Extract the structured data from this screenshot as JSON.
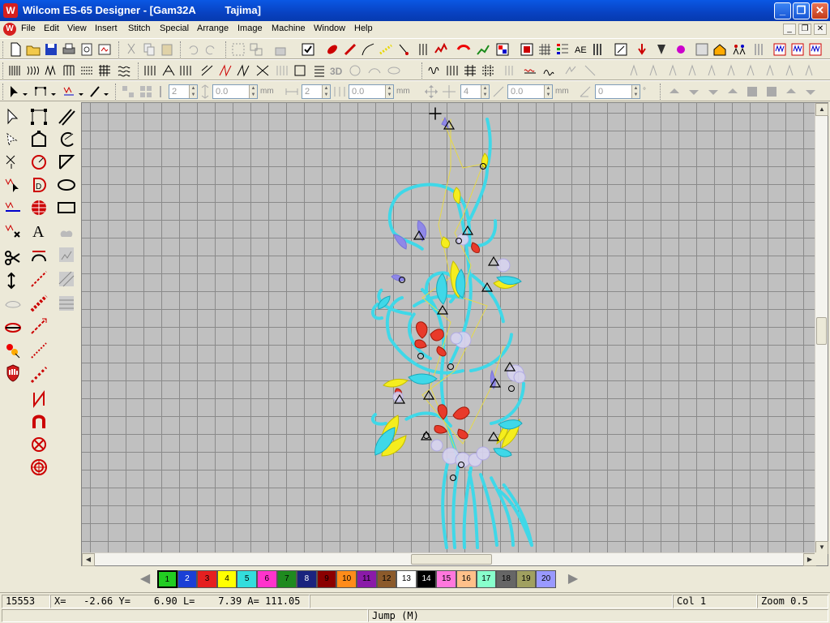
{
  "window": {
    "title": "Wilcom ES-65 Designer - [Gam32A          Tajima]",
    "minimize": "_",
    "restore": "❐",
    "close": "✕",
    "app_logo": "W"
  },
  "menu": {
    "items": [
      "File",
      "Edit",
      "View",
      "Insert",
      "Stitch",
      "Special",
      "Arrange",
      "Image",
      "Machine",
      "Window",
      "Help"
    ],
    "child_window_buttons": [
      "_",
      "❐",
      "✕"
    ]
  },
  "toolbars": {
    "row3_fields": {
      "field1": "2",
      "field2": "0.0",
      "unit1": "mm",
      "field3": "2",
      "field4": "0.0",
      "unit2": "mm",
      "field5": "4",
      "field6": "0.0",
      "unit3": "mm",
      "field7": "0",
      "unit4": "°"
    },
    "label_3d": "3D"
  },
  "canvas": {
    "background": "#c0c0c0",
    "grid_color": "#8a8a8a"
  },
  "colorbar": {
    "left_arrow": "◀",
    "right_arrow": "▶",
    "selected": 1,
    "swatches": [
      {
        "n": "1",
        "color": "#22cc22"
      },
      {
        "n": "2",
        "color": "#1a3fd6"
      },
      {
        "n": "3",
        "color": "#e52020"
      },
      {
        "n": "4",
        "color": "#ffff00"
      },
      {
        "n": "5",
        "color": "#33dddd"
      },
      {
        "n": "6",
        "color": "#ff33cc"
      },
      {
        "n": "7",
        "color": "#1f8a1f"
      },
      {
        "n": "8",
        "color": "#1a237e"
      },
      {
        "n": "9",
        "color": "#8b0000"
      },
      {
        "n": "10",
        "color": "#ff8c1a"
      },
      {
        "n": "11",
        "color": "#8a1aa8"
      },
      {
        "n": "12",
        "color": "#8b5a2b"
      },
      {
        "n": "13",
        "color": "#ffffff"
      },
      {
        "n": "14",
        "color": "#000000"
      },
      {
        "n": "15",
        "color": "#ff77dd"
      },
      {
        "n": "16",
        "color": "#ffc08a"
      },
      {
        "n": "17",
        "color": "#88ffcc"
      },
      {
        "n": "18",
        "color": "#666666"
      },
      {
        "n": "19",
        "color": "#a0a060"
      },
      {
        "n": "20",
        "color": "#9999ff"
      }
    ]
  },
  "status": {
    "stitch_count": "15553",
    "coords": "X=   -2.66 Y=    6.90 L=    7.39 A= 111.05",
    "col": "Col 1",
    "zoom": "Zoom 0.5",
    "mode": "Jump (M)"
  }
}
